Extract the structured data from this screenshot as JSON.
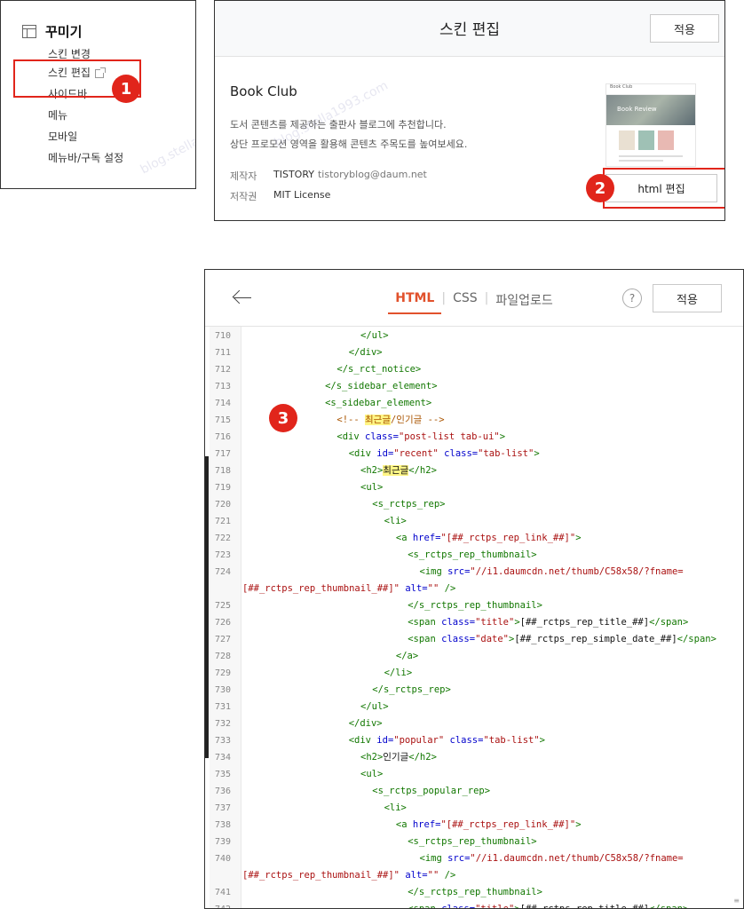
{
  "customize_menu": {
    "title": "꾸미기",
    "items": [
      {
        "label": "스킨 변경"
      },
      {
        "label": "스킨 편집"
      },
      {
        "label": "사이드바"
      },
      {
        "label": "메뉴"
      },
      {
        "label": "모바일"
      },
      {
        "label": "메뉴바/구독 설정"
      }
    ]
  },
  "skin_panel": {
    "title": "스킨 편집",
    "apply_label": "적용",
    "skin_name": "Book Club",
    "description": [
      "도서 콘텐츠를 제공하는 출판사 블로그에 추천합니다.",
      "상단 프로모션 영역을 활용해 콘텐츠 주목도를 높여보세요."
    ],
    "author_label": "제작자",
    "author_name": "TISTORY",
    "author_email": "tistoryblog@daum.net",
    "license_label": "저작권",
    "license_value": "MIT License",
    "thumbnail_title": "Book Club",
    "thumbnail_hero_text": "Book Review",
    "html_edit_label": "html 편집"
  },
  "editor": {
    "tabs": [
      {
        "label": "HTML",
        "active": true
      },
      {
        "label": "CSS",
        "active": false
      },
      {
        "label": "파일업로드",
        "active": false
      }
    ],
    "help_label": "?",
    "apply_label": "적용"
  },
  "steps": [
    "1",
    "2",
    "3"
  ],
  "watermark": "blog.stella1993.com",
  "colors": {
    "accent_red": "#e1251b",
    "tab_active": "#e1512c",
    "tag": "#117700",
    "attr": "#0000cc",
    "string": "#aa1111",
    "comment": "#aa5500",
    "highlight": "#fff585"
  },
  "code_lines": [
    {
      "n": "710",
      "indent": 10,
      "segs": [
        [
          "tag",
          "</ul>"
        ]
      ]
    },
    {
      "n": "711",
      "indent": 9,
      "segs": [
        [
          "tag",
          "</div>"
        ]
      ]
    },
    {
      "n": "712",
      "indent": 8,
      "segs": [
        [
          "tag",
          "</s_rct_notice>"
        ]
      ]
    },
    {
      "n": "713",
      "indent": 7,
      "segs": [
        [
          "tag",
          "</s_sidebar_element>"
        ]
      ]
    },
    {
      "n": "714",
      "indent": 7,
      "segs": [
        [
          "tag",
          "<s_sidebar_element>"
        ]
      ]
    },
    {
      "n": "715",
      "indent": 8,
      "segs": [
        [
          "cmt",
          "<!-- "
        ],
        [
          "cmt-hl",
          "최근글"
        ],
        [
          "cmt",
          "/인기글 -->"
        ]
      ]
    },
    {
      "n": "716",
      "indent": 8,
      "segs": [
        [
          "tag",
          "<div "
        ],
        [
          "attr",
          "class="
        ],
        [
          "str",
          "\"post-list tab-ui\""
        ],
        [
          "tag",
          ">"
        ]
      ]
    },
    {
      "n": "717",
      "indent": 9,
      "segs": [
        [
          "tag",
          "<div "
        ],
        [
          "attr",
          "id="
        ],
        [
          "str",
          "\"recent\""
        ],
        [
          "txt",
          " "
        ],
        [
          "attr",
          "class="
        ],
        [
          "str",
          "\"tab-list\""
        ],
        [
          "tag",
          ">"
        ]
      ]
    },
    {
      "n": "718",
      "indent": 10,
      "segs": [
        [
          "tag",
          "<h2>"
        ],
        [
          "txt-hl",
          "최근글"
        ],
        [
          "tag",
          "</h2>"
        ]
      ]
    },
    {
      "n": "719",
      "indent": 10,
      "segs": [
        [
          "tag",
          "<ul>"
        ]
      ]
    },
    {
      "n": "720",
      "indent": 11,
      "segs": [
        [
          "tag",
          "<s_rctps_rep>"
        ]
      ]
    },
    {
      "n": "721",
      "indent": 12,
      "segs": [
        [
          "tag",
          "<li>"
        ]
      ]
    },
    {
      "n": "722",
      "indent": 13,
      "segs": [
        [
          "tag",
          "<a "
        ],
        [
          "attr",
          "href="
        ],
        [
          "str",
          "\"[##_rctps_rep_link_##]\""
        ],
        [
          "tag",
          ">"
        ]
      ]
    },
    {
      "n": "723",
      "indent": 14,
      "segs": [
        [
          "tag",
          "<s_rctps_rep_thumbnail>"
        ]
      ]
    },
    {
      "n": "724",
      "indent": 15,
      "segs": [
        [
          "tag",
          "<img "
        ],
        [
          "attr",
          "src="
        ],
        [
          "str",
          "\"//i1.daumcdn.net/thumb/C58x58/?fname="
        ]
      ]
    },
    {
      "n": "",
      "indent": 0,
      "segs": [
        [
          "str",
          "[##_rctps_rep_thumbnail_##]\""
        ],
        [
          "txt",
          " "
        ],
        [
          "attr",
          "alt="
        ],
        [
          "str",
          "\"\""
        ],
        [
          "txt",
          " "
        ],
        [
          "tag",
          "/>"
        ]
      ]
    },
    {
      "n": "725",
      "indent": 14,
      "segs": [
        [
          "tag",
          "</s_rctps_rep_thumbnail>"
        ]
      ]
    },
    {
      "n": "726",
      "indent": 14,
      "segs": [
        [
          "tag",
          "<span "
        ],
        [
          "attr",
          "class="
        ],
        [
          "str",
          "\"title\""
        ],
        [
          "tag",
          ">"
        ],
        [
          "txt",
          "[##_rctps_rep_title_##]"
        ],
        [
          "tag",
          "</span>"
        ]
      ]
    },
    {
      "n": "727",
      "indent": 14,
      "segs": [
        [
          "tag",
          "<span "
        ],
        [
          "attr",
          "class="
        ],
        [
          "str",
          "\"date\""
        ],
        [
          "tag",
          ">"
        ],
        [
          "txt",
          "[##_rctps_rep_simple_date_##]"
        ],
        [
          "tag",
          "</span>"
        ]
      ]
    },
    {
      "n": "728",
      "indent": 13,
      "segs": [
        [
          "tag",
          "</a>"
        ]
      ]
    },
    {
      "n": "729",
      "indent": 12,
      "segs": [
        [
          "tag",
          "</li>"
        ]
      ]
    },
    {
      "n": "730",
      "indent": 11,
      "segs": [
        [
          "tag",
          "</s_rctps_rep>"
        ]
      ]
    },
    {
      "n": "731",
      "indent": 10,
      "segs": [
        [
          "tag",
          "</ul>"
        ]
      ]
    },
    {
      "n": "732",
      "indent": 9,
      "segs": [
        [
          "tag",
          "</div>"
        ]
      ]
    },
    {
      "n": "733",
      "indent": 9,
      "segs": [
        [
          "tag",
          "<div "
        ],
        [
          "attr",
          "id="
        ],
        [
          "str",
          "\"popular\""
        ],
        [
          "txt",
          " "
        ],
        [
          "attr",
          "class="
        ],
        [
          "str",
          "\"tab-list\""
        ],
        [
          "tag",
          ">"
        ]
      ]
    },
    {
      "n": "734",
      "indent": 10,
      "segs": [
        [
          "tag",
          "<h2>"
        ],
        [
          "txt",
          "인기글"
        ],
        [
          "tag",
          "</h2>"
        ]
      ]
    },
    {
      "n": "735",
      "indent": 10,
      "segs": [
        [
          "tag",
          "<ul>"
        ]
      ]
    },
    {
      "n": "736",
      "indent": 11,
      "segs": [
        [
          "tag",
          "<s_rctps_popular_rep>"
        ]
      ]
    },
    {
      "n": "737",
      "indent": 12,
      "segs": [
        [
          "tag",
          "<li>"
        ]
      ]
    },
    {
      "n": "738",
      "indent": 13,
      "segs": [
        [
          "tag",
          "<a "
        ],
        [
          "attr",
          "href="
        ],
        [
          "str",
          "\"[##_rctps_rep_link_##]\""
        ],
        [
          "tag",
          ">"
        ]
      ]
    },
    {
      "n": "739",
      "indent": 14,
      "segs": [
        [
          "tag",
          "<s_rctps_rep_thumbnail>"
        ]
      ]
    },
    {
      "n": "740",
      "indent": 15,
      "segs": [
        [
          "tag",
          "<img "
        ],
        [
          "attr",
          "src="
        ],
        [
          "str",
          "\"//i1.daumcdn.net/thumb/C58x58/?fname="
        ]
      ]
    },
    {
      "n": "",
      "indent": 0,
      "segs": [
        [
          "str",
          "[##_rctps_rep_thumbnail_##]\""
        ],
        [
          "txt",
          " "
        ],
        [
          "attr",
          "alt="
        ],
        [
          "str",
          "\"\""
        ],
        [
          "txt",
          " "
        ],
        [
          "tag",
          "/>"
        ]
      ]
    },
    {
      "n": "741",
      "indent": 14,
      "segs": [
        [
          "tag",
          "</s_rctps_rep_thumbnail>"
        ]
      ]
    },
    {
      "n": "742",
      "indent": 14,
      "segs": [
        [
          "tag",
          "<span "
        ],
        [
          "attr",
          "class="
        ],
        [
          "str",
          "\"title\""
        ],
        [
          "tag",
          ">"
        ],
        [
          "txt",
          "[##_rctps_rep_title_##]"
        ],
        [
          "tag",
          "</span>"
        ]
      ]
    }
  ]
}
